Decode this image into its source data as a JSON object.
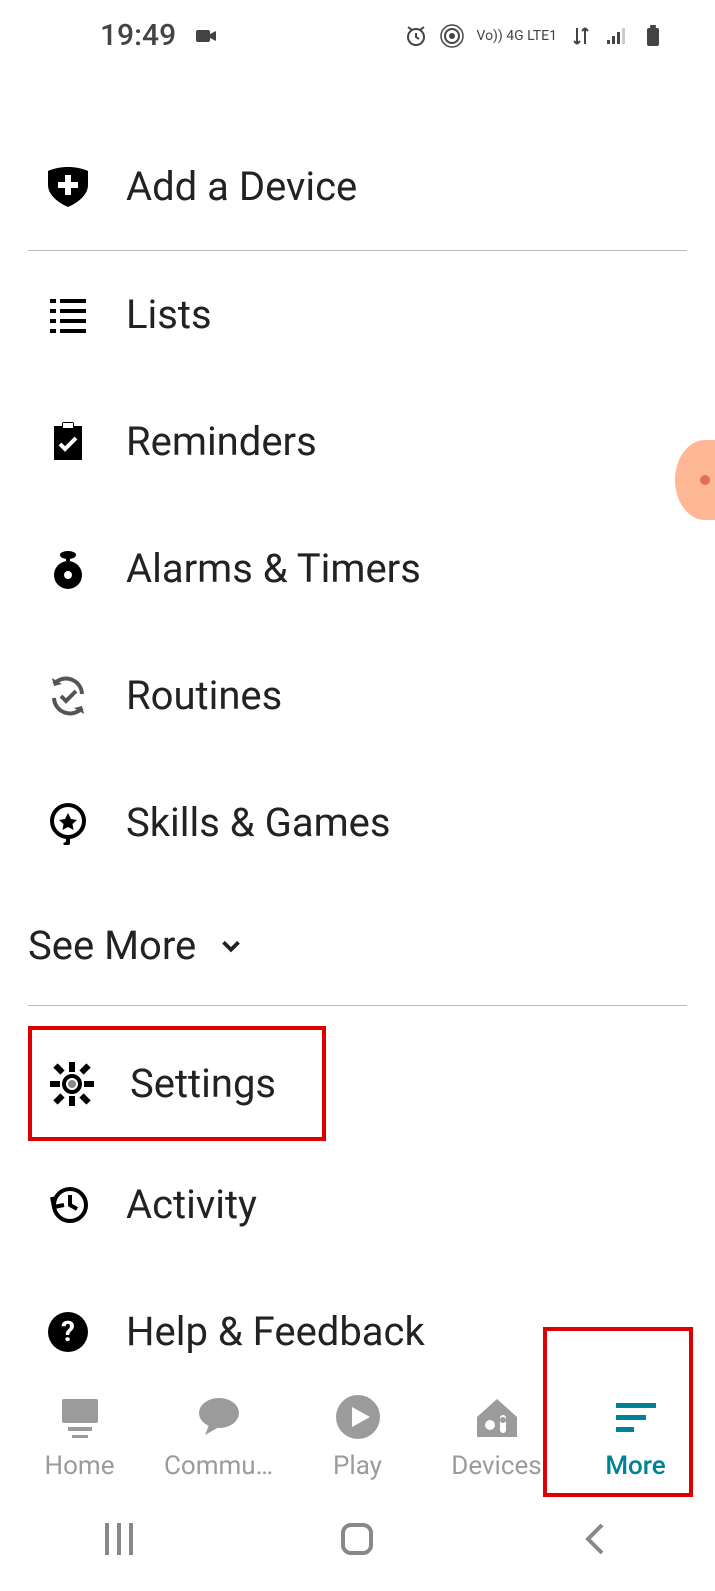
{
  "status": {
    "time": "19:49",
    "net_label": "Vo)) 4G LTE1"
  },
  "menu": {
    "add_device": "Add a Device",
    "lists": "Lists",
    "reminders": "Reminders",
    "alarms": "Alarms & Timers",
    "routines": "Routines",
    "skills": "Skills & Games",
    "see_more": "See More",
    "settings": "Settings",
    "activity": "Activity",
    "help": "Help & Feedback"
  },
  "tabs": {
    "home": "Home",
    "communicate": "Commu…",
    "play": "Play",
    "devices": "Devices",
    "more": "More"
  }
}
